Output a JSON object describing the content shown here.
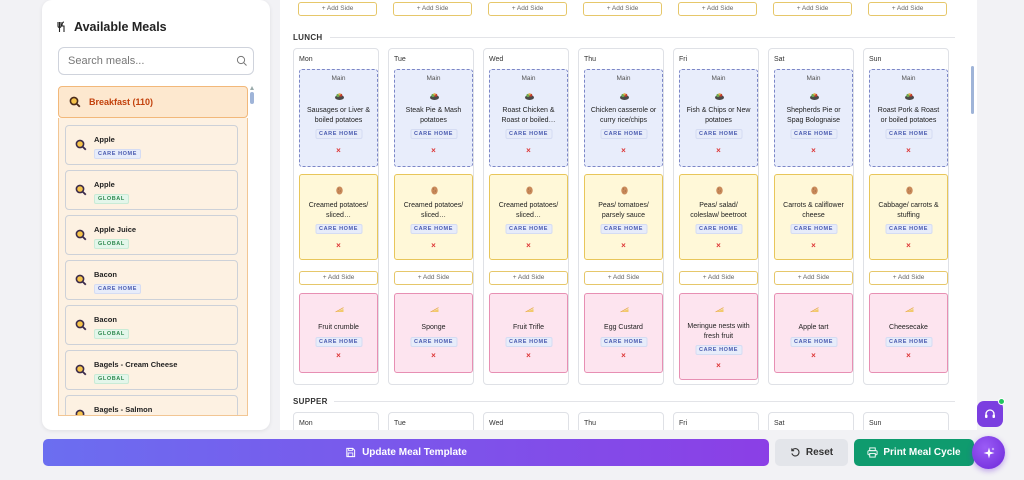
{
  "sidebar": {
    "title": "Available Meals",
    "search_placeholder": "Search meals...",
    "group_label": "Breakfast (110)",
    "items": [
      {
        "name": "Apple",
        "tag": "CARE HOME",
        "tag_type": "care"
      },
      {
        "name": "Apple",
        "tag": "GLOBAL",
        "tag_type": "global"
      },
      {
        "name": "Apple Juice",
        "tag": "GLOBAL",
        "tag_type": "global"
      },
      {
        "name": "Bacon",
        "tag": "CARE HOME",
        "tag_type": "care"
      },
      {
        "name": "Bacon",
        "tag": "GLOBAL",
        "tag_type": "global"
      },
      {
        "name": "Bagels - Cream Cheese",
        "tag": "GLOBAL",
        "tag_type": "global"
      },
      {
        "name": "Bagels - Salmon",
        "tag": "",
        "tag_type": "global"
      }
    ]
  },
  "top_row": {
    "add_side_label": "+ Add Side"
  },
  "lunch": {
    "label": "LUNCH",
    "main_kind": "Main",
    "tag": "CARE HOME",
    "remove": "×",
    "add_side_label": "+ Add Side",
    "days": [
      {
        "day": "Mon",
        "main": "Sausages or Liver & boiled potatoes",
        "side": "Creamed potatoes/ sliced…",
        "dessert": "Fruit crumble"
      },
      {
        "day": "Tue",
        "main": "Steak Pie & Mash potatoes",
        "side": "Creamed potatoes/ sliced…",
        "dessert": "Sponge"
      },
      {
        "day": "Wed",
        "main": "Roast Chicken & Roast or boiled…",
        "side": "Creamed potatoes/ sliced…",
        "dessert": "Fruit Trifle"
      },
      {
        "day": "Thu",
        "main": "Chicken casserole or curry rice/chips",
        "side": "Peas/ tomatoes/ parsely sauce",
        "dessert": "Egg Custard"
      },
      {
        "day": "Fri",
        "main": "Fish & Chips or New potatoes",
        "side": "Peas/ salad/ coleslaw/ beetroot",
        "dessert": "Meringue nests with fresh fruit"
      },
      {
        "day": "Sat",
        "main": "Shepherds Pie or Spag Bolognaise",
        "side": "Carrots & califlower cheese",
        "dessert": "Apple tart"
      },
      {
        "day": "Sun",
        "main": "Roast Pork & Roast or boiled potatoes",
        "side": "Cabbage/ carrots & stuffing",
        "dessert": "Cheesecake"
      }
    ]
  },
  "supper": {
    "label": "SUPPER",
    "days": [
      "Mon",
      "Tue",
      "Wed",
      "Thu",
      "Fri",
      "Sat",
      "Sun"
    ]
  },
  "actions": {
    "update_label": "Update Meal Template",
    "reset_label": "Reset",
    "print_label": "Print Meal Cycle"
  },
  "colors": {
    "accent": "#8b3fe6",
    "print": "#0f9b6e",
    "breakfast": "#c2410c"
  }
}
